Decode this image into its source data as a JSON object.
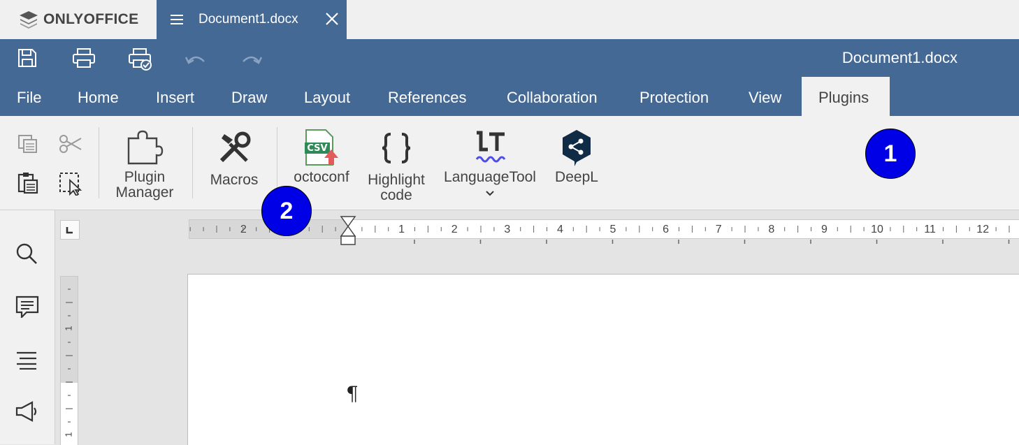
{
  "app": {
    "logo_text": "ONLYOFFICE"
  },
  "tab": {
    "title": "Document1.docx"
  },
  "header": {
    "document_title": "Document1.docx"
  },
  "menu_tabs": [
    {
      "label": "File"
    },
    {
      "label": "Home"
    },
    {
      "label": "Insert"
    },
    {
      "label": "Draw"
    },
    {
      "label": "Layout"
    },
    {
      "label": "References"
    },
    {
      "label": "Collaboration"
    },
    {
      "label": "Protection"
    },
    {
      "label": "View"
    },
    {
      "label": "Plugins",
      "active": true
    }
  ],
  "toolbar": {
    "plugin_manager": "Plugin\nManager",
    "macros": "Macros",
    "octoconf": "octoconf",
    "highlight_code": "Highlight\ncode",
    "languagetool": "LanguageTool",
    "deepl": "DeepL",
    "csv_icon_text": "CSV"
  },
  "annotations": {
    "badge_1": "1",
    "badge_2": "2"
  },
  "ruler": {
    "left_numbers": [
      "2"
    ],
    "right_numbers": [
      "1",
      "2",
      "3",
      "4",
      "5",
      "6",
      "7",
      "8",
      "9",
      "10",
      "11",
      "12"
    ],
    "vertical_numbers": [
      "1",
      "1"
    ]
  },
  "document": {
    "pilcrow": "¶"
  },
  "colors": {
    "brand": "#446995",
    "badge": "#0000e6"
  }
}
